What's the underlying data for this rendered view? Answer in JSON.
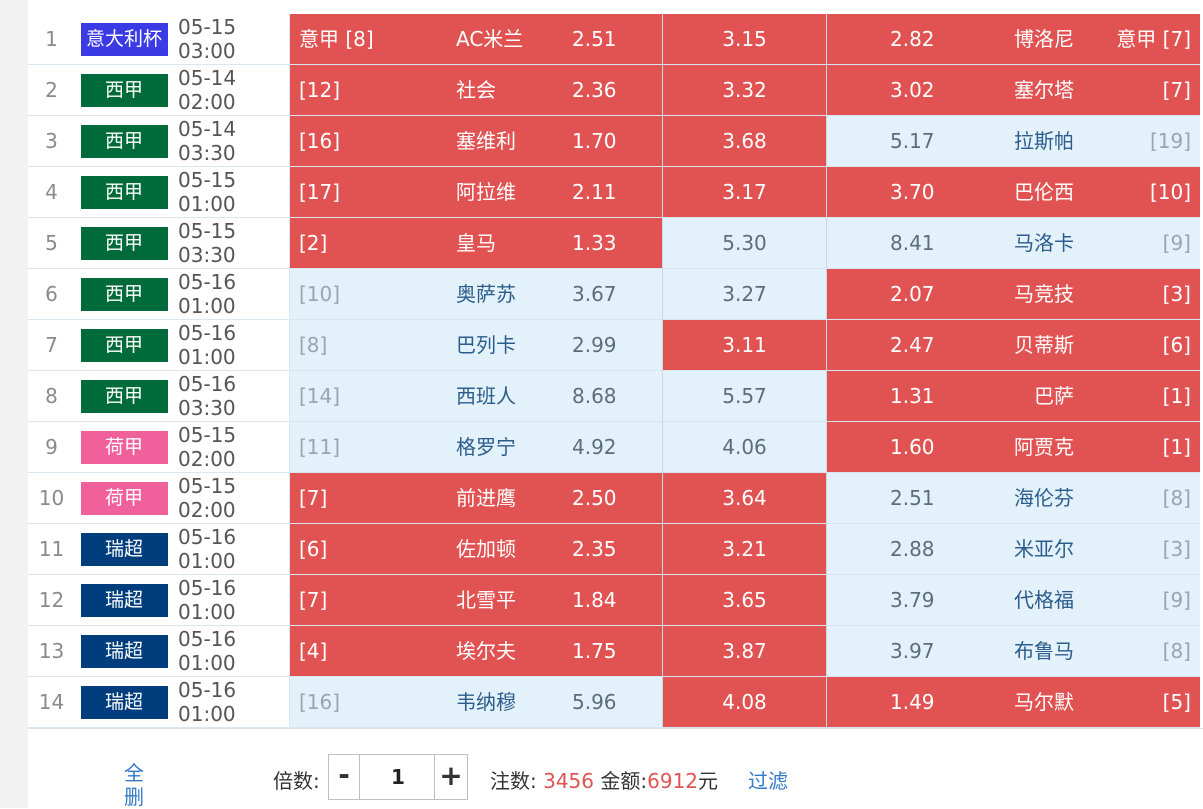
{
  "colors": {
    "red_cell": "#e05352",
    "blue_cell": "#e3f1fb",
    "link": "#3478c8"
  },
  "matches": [
    {
      "idx": "1",
      "league": "意大利杯",
      "league_color": "#3b3be6",
      "time": "05-15 03:00",
      "home_rank": "意甲 [8]",
      "home_team": "AC米兰",
      "home_odds": "2.51",
      "home_sel": true,
      "draw_odds": "3.15",
      "draw_sel": true,
      "away_odds": "2.82",
      "away_team": "博洛尼",
      "away_rank": "意甲 [7]",
      "away_sel": true
    },
    {
      "idx": "2",
      "league": "西甲",
      "league_color": "#006b3a",
      "time": "05-14 02:00",
      "home_rank": "[12]",
      "home_team": "社会",
      "home_odds": "2.36",
      "home_sel": true,
      "draw_odds": "3.32",
      "draw_sel": true,
      "away_odds": "3.02",
      "away_team": "塞尔塔",
      "away_rank": "[7]",
      "away_sel": true
    },
    {
      "idx": "3",
      "league": "西甲",
      "league_color": "#006b3a",
      "time": "05-14 03:30",
      "home_rank": "[16]",
      "home_team": "塞维利",
      "home_odds": "1.70",
      "home_sel": true,
      "draw_odds": "3.68",
      "draw_sel": true,
      "away_odds": "5.17",
      "away_team": "拉斯帕",
      "away_rank": "[19]",
      "away_sel": false
    },
    {
      "idx": "4",
      "league": "西甲",
      "league_color": "#006b3a",
      "time": "05-15 01:00",
      "home_rank": "[17]",
      "home_team": "阿拉维",
      "home_odds": "2.11",
      "home_sel": true,
      "draw_odds": "3.17",
      "draw_sel": true,
      "away_odds": "3.70",
      "away_team": "巴伦西",
      "away_rank": "[10]",
      "away_sel": true
    },
    {
      "idx": "5",
      "league": "西甲",
      "league_color": "#006b3a",
      "time": "05-15 03:30",
      "home_rank": "[2]",
      "home_team": "皇马",
      "home_odds": "1.33",
      "home_sel": true,
      "draw_odds": "5.30",
      "draw_sel": false,
      "away_odds": "8.41",
      "away_team": "马洛卡",
      "away_rank": "[9]",
      "away_sel": false
    },
    {
      "idx": "6",
      "league": "西甲",
      "league_color": "#006b3a",
      "time": "05-16 01:00",
      "home_rank": "[10]",
      "home_team": "奥萨苏",
      "home_odds": "3.67",
      "home_sel": false,
      "draw_odds": "3.27",
      "draw_sel": false,
      "away_odds": "2.07",
      "away_team": "马竞技",
      "away_rank": "[3]",
      "away_sel": true
    },
    {
      "idx": "7",
      "league": "西甲",
      "league_color": "#006b3a",
      "time": "05-16 01:00",
      "home_rank": "[8]",
      "home_team": "巴列卡",
      "home_odds": "2.99",
      "home_sel": false,
      "draw_odds": "3.11",
      "draw_sel": true,
      "away_odds": "2.47",
      "away_team": "贝蒂斯",
      "away_rank": "[6]",
      "away_sel": true
    },
    {
      "idx": "8",
      "league": "西甲",
      "league_color": "#006b3a",
      "time": "05-16 03:30",
      "home_rank": "[14]",
      "home_team": "西班人",
      "home_odds": "8.68",
      "home_sel": false,
      "draw_odds": "5.57",
      "draw_sel": false,
      "away_odds": "1.31",
      "away_team": "巴萨",
      "away_rank": "[1]",
      "away_sel": true
    },
    {
      "idx": "9",
      "league": "荷甲",
      "league_color": "#f0609a",
      "time": "05-15 02:00",
      "home_rank": "[11]",
      "home_team": "格罗宁",
      "home_odds": "4.92",
      "home_sel": false,
      "draw_odds": "4.06",
      "draw_sel": false,
      "away_odds": "1.60",
      "away_team": "阿贾克",
      "away_rank": "[1]",
      "away_sel": true
    },
    {
      "idx": "10",
      "league": "荷甲",
      "league_color": "#f0609a",
      "time": "05-15 02:00",
      "home_rank": "[7]",
      "home_team": "前进鹰",
      "home_odds": "2.50",
      "home_sel": true,
      "draw_odds": "3.64",
      "draw_sel": true,
      "away_odds": "2.51",
      "away_team": "海伦芬",
      "away_rank": "[8]",
      "away_sel": false
    },
    {
      "idx": "11",
      "league": "瑞超",
      "league_color": "#003d7d",
      "time": "05-16 01:00",
      "home_rank": "[6]",
      "home_team": "佐加顿",
      "home_odds": "2.35",
      "home_sel": true,
      "draw_odds": "3.21",
      "draw_sel": true,
      "away_odds": "2.88",
      "away_team": "米亚尔",
      "away_rank": "[3]",
      "away_sel": false
    },
    {
      "idx": "12",
      "league": "瑞超",
      "league_color": "#003d7d",
      "time": "05-16 01:00",
      "home_rank": "[7]",
      "home_team": "北雪平",
      "home_odds": "1.84",
      "home_sel": true,
      "draw_odds": "3.65",
      "draw_sel": true,
      "away_odds": "3.79",
      "away_team": "代格福",
      "away_rank": "[9]",
      "away_sel": false
    },
    {
      "idx": "13",
      "league": "瑞超",
      "league_color": "#003d7d",
      "time": "05-16 01:00",
      "home_rank": "[4]",
      "home_team": "埃尔夫",
      "home_odds": "1.75",
      "home_sel": true,
      "draw_odds": "3.87",
      "draw_sel": true,
      "away_odds": "3.97",
      "away_team": "布鲁马",
      "away_rank": "[8]",
      "away_sel": false
    },
    {
      "idx": "14",
      "league": "瑞超",
      "league_color": "#003d7d",
      "time": "05-16 01:00",
      "home_rank": "[16]",
      "home_team": "韦纳穆",
      "home_odds": "5.96",
      "home_sel": false,
      "draw_odds": "4.08",
      "draw_sel": true,
      "away_odds": "1.49",
      "away_team": "马尔默",
      "away_rank": "[5]",
      "away_sel": true
    }
  ],
  "footer": {
    "delete_all": "全删",
    "multiplier_label": "倍数:",
    "minus": "-",
    "multiplier_value": "1",
    "plus": "+",
    "bets_label": "注数:",
    "bets_count": "3456",
    "amount_label": "金额:",
    "amount_value": "6912",
    "amount_unit": "元",
    "filter": "过滤"
  }
}
